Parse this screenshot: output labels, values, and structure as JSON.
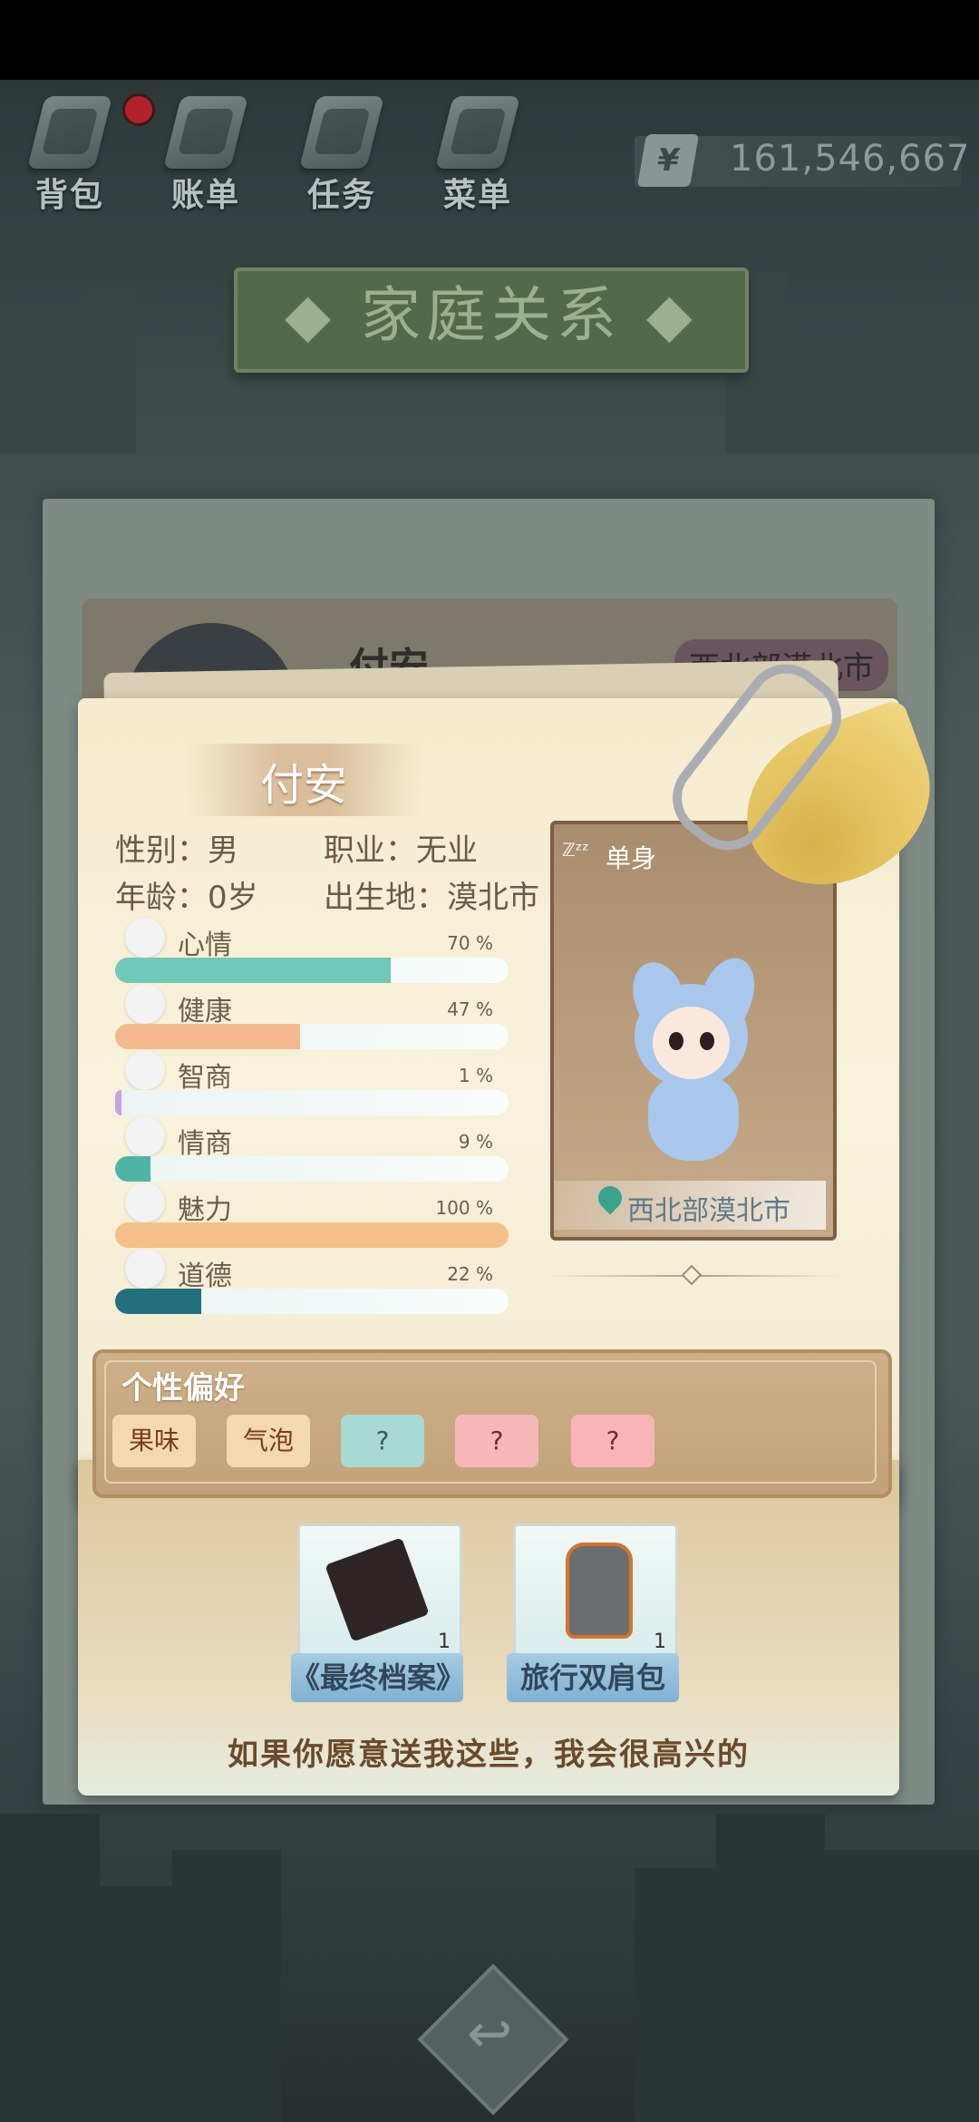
{
  "top_menu": {
    "items": [
      {
        "label": "背包",
        "icon": "backpack-icon"
      },
      {
        "label": "账单",
        "icon": "bill-icon"
      },
      {
        "label": "任务",
        "icon": "task-icon"
      },
      {
        "label": "菜单",
        "icon": "menu-icon"
      }
    ],
    "currency": {
      "symbol": "¥",
      "amount": "161,546,667"
    }
  },
  "page_title": "家庭关系",
  "back_card": {
    "name": "付安",
    "region": "西北部漠北市"
  },
  "character": {
    "name": "付安",
    "gender_label": "性别：",
    "gender": "男",
    "job_label": "职业：",
    "job": "无业",
    "age_label": "年龄：",
    "age": "0岁",
    "birthplace_label": "出生地：",
    "birthplace": "漠北市",
    "relationship_status": "单身",
    "status_icon": "sleep-zzz-icon",
    "region": "西北部漠北市"
  },
  "stats": [
    {
      "label": "心情",
      "pct_text": "70 %",
      "value": 0.7,
      "color": "#6fc8b8",
      "icon": "smile-icon"
    },
    {
      "label": "健康",
      "pct_text": "47 %",
      "value": 0.47,
      "color": "#f4b98c",
      "icon": "heart-icon"
    },
    {
      "label": "智商",
      "pct_text": "1 %",
      "value": 0.01,
      "color": "#c4a6de",
      "icon": "bulb-icon"
    },
    {
      "label": "情商",
      "pct_text": "9 %",
      "value": 0.09,
      "color": "#4fb4a6",
      "icon": "apple-icon"
    },
    {
      "label": "魅力",
      "pct_text": "100 %",
      "value": 1.0,
      "color": "#f6c08a",
      "icon": "sparkle-icon"
    },
    {
      "label": "道德",
      "pct_text": "22 %",
      "value": 0.22,
      "color": "#22707e",
      "icon": "scale-icon"
    }
  ],
  "preferences": {
    "title": "个性偏好",
    "items": [
      {
        "label": "果味",
        "bg": "#f3d9b0",
        "fg": "#7a3a1a"
      },
      {
        "label": "气泡",
        "bg": "#f3d9b0",
        "fg": "#7a3a1a"
      },
      {
        "label": "?",
        "bg": "#a9d9d3",
        "fg": "#355a5a"
      },
      {
        "label": "?",
        "bg": "#f6b8b8",
        "fg": "#6a3030"
      },
      {
        "label": "?",
        "bg": "#f9b4b8",
        "fg": "#6a3030"
      }
    ]
  },
  "gifts": [
    {
      "label": "《最终档案》",
      "count": "1",
      "icon": "book-icon"
    },
    {
      "label": "旅行双肩包",
      "count": "1",
      "icon": "backpack-icon"
    }
  ],
  "gift_message": "如果你愿意送我这些，我会很高兴的",
  "back_button_icon": "return-arrow-icon"
}
